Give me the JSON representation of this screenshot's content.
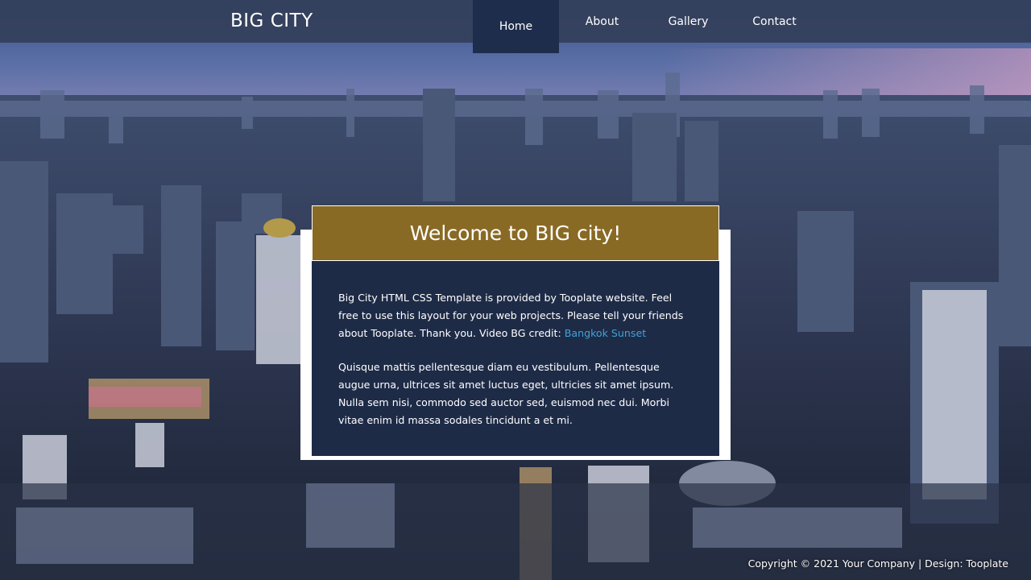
{
  "header": {
    "brand": "BIG CITY",
    "nav": [
      {
        "label": "Home",
        "active": true
      },
      {
        "label": "About",
        "active": false
      },
      {
        "label": "Gallery",
        "active": false
      },
      {
        "label": "Contact",
        "active": false
      }
    ]
  },
  "welcome": {
    "title": "Welcome to BIG city!",
    "para1_text": "Big City HTML CSS Template is provided by Tooplate website. Feel free to use this layout for your web projects. Please tell your friends about Tooplate. Thank you. Video BG credit: ",
    "para1_link": "Bangkok Sunset",
    "para2": "Quisque mattis pellentesque diam eu vestibulum. Pellentesque augue urna, ultrices sit amet luctus eget, ultricies sit amet ipsum. Nulla sem nisi, commodo sed auctor sed, euismod nec dui. Morbi vitae enim id massa sodales tincidunt a et mi."
  },
  "footer": {
    "text": "Copyright © 2021 Your Company | Design: Tooplate"
  },
  "colors": {
    "nav_bg": "#343f5a",
    "nav_active": "#1e2d4c",
    "card_header": "#896a24",
    "card_body": "#1e2b47",
    "link": "#3fa3d8"
  }
}
